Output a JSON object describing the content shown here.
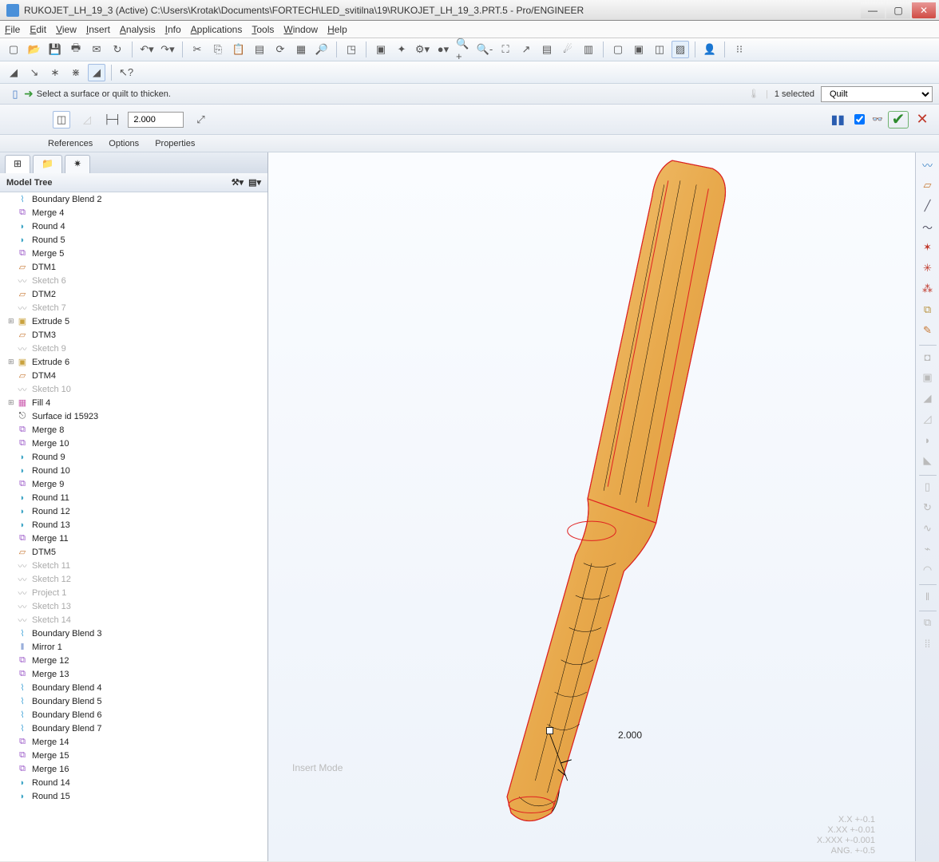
{
  "title": "RUKOJET_LH_19_3 (Active) C:\\Users\\Krotak\\Documents\\FORTECH\\LED_svitilna\\19\\RUKOJET_LH_19_3.PRT.5 - Pro/ENGINEER",
  "menu": [
    "File",
    "Edit",
    "View",
    "Insert",
    "Analysis",
    "Info",
    "Applications",
    "Tools",
    "Window",
    "Help"
  ],
  "prompt": {
    "msg": "Select a surface or quilt to thicken.",
    "count": "1 selected",
    "filter": "Quilt"
  },
  "dash": {
    "thickness": "2.000",
    "tabs": [
      "References",
      "Options",
      "Properties"
    ]
  },
  "panelTitle": "Model Tree",
  "tree": [
    {
      "l": "Boundary Blend 2",
      "i": "blend"
    },
    {
      "l": "Merge 4",
      "i": "merge"
    },
    {
      "l": "Round 4",
      "i": "round"
    },
    {
      "l": "Round 5",
      "i": "round"
    },
    {
      "l": "Merge 5",
      "i": "merge"
    },
    {
      "l": "DTM1",
      "i": "dtm"
    },
    {
      "l": "Sketch 6",
      "i": "sketch",
      "d": 1
    },
    {
      "l": "DTM2",
      "i": "dtm"
    },
    {
      "l": "Sketch 7",
      "i": "sketch",
      "d": 1
    },
    {
      "l": "Extrude 5",
      "i": "extrude",
      "e": 1
    },
    {
      "l": "DTM3",
      "i": "dtm"
    },
    {
      "l": "Sketch 9",
      "i": "sketch",
      "d": 1
    },
    {
      "l": "Extrude 6",
      "i": "extrude",
      "e": 1
    },
    {
      "l": "DTM4",
      "i": "dtm"
    },
    {
      "l": "Sketch 10",
      "i": "sketch",
      "d": 1
    },
    {
      "l": "Fill 4",
      "i": "fill",
      "e": 1
    },
    {
      "l": "Surface id 15923",
      "i": "surf"
    },
    {
      "l": "Merge 8",
      "i": "merge"
    },
    {
      "l": "Merge 10",
      "i": "merge"
    },
    {
      "l": "Round 9",
      "i": "round"
    },
    {
      "l": "Round 10",
      "i": "round"
    },
    {
      "l": "Merge 9",
      "i": "merge"
    },
    {
      "l": "Round 11",
      "i": "round"
    },
    {
      "l": "Round 12",
      "i": "round"
    },
    {
      "l": "Round 13",
      "i": "round"
    },
    {
      "l": "Merge 11",
      "i": "merge"
    },
    {
      "l": "DTM5",
      "i": "dtm"
    },
    {
      "l": "Sketch 11",
      "i": "sketch",
      "d": 1
    },
    {
      "l": "Sketch 12",
      "i": "sketch",
      "d": 1
    },
    {
      "l": "Project 1",
      "i": "sketch",
      "d": 1
    },
    {
      "l": "Sketch 13",
      "i": "sketch",
      "d": 1
    },
    {
      "l": "Sketch 14",
      "i": "sketch",
      "d": 1
    },
    {
      "l": "Boundary Blend 3",
      "i": "blend"
    },
    {
      "l": "Mirror 1",
      "i": "mirror"
    },
    {
      "l": "Merge 12",
      "i": "merge"
    },
    {
      "l": "Merge 13",
      "i": "merge"
    },
    {
      "l": "Boundary Blend 4",
      "i": "blend"
    },
    {
      "l": "Boundary Blend 5",
      "i": "blend"
    },
    {
      "l": "Boundary Blend 6",
      "i": "blend"
    },
    {
      "l": "Boundary Blend 7",
      "i": "blend"
    },
    {
      "l": "Merge 14",
      "i": "merge"
    },
    {
      "l": "Merge 15",
      "i": "merge"
    },
    {
      "l": "Merge 16",
      "i": "merge"
    },
    {
      "l": "Round 14",
      "i": "round"
    },
    {
      "l": "Round 15",
      "i": "round"
    }
  ],
  "viewport": {
    "insert": "Insert Mode",
    "dim": "2.000",
    "precision": [
      "X.X +-0.1",
      "X.XX +-0.01",
      "X.XXX +-0.001",
      "ANG. +-0.5"
    ]
  },
  "iconGlyph": {
    "blend": "⌇",
    "merge": "⧉",
    "round": "◗",
    "dtm": "▱",
    "sketch": "〰",
    "extrude": "▣",
    "fill": "▦",
    "surf": "⎋",
    "mirror": "‖"
  }
}
